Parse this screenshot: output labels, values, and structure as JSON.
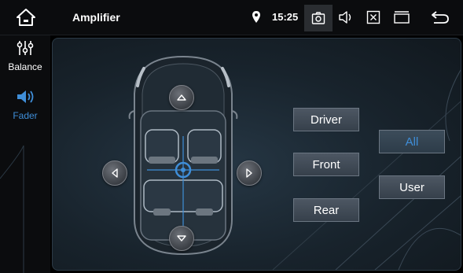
{
  "header": {
    "title": "Amplifier",
    "time": "15:25",
    "icons": [
      "home-icon",
      "location-pin-icon",
      "camera-icon",
      "volume-icon",
      "close-box-icon",
      "window-icon",
      "back-icon"
    ]
  },
  "sidebar": {
    "items": [
      {
        "label": "Balance",
        "icon": "sliders-icon",
        "active": false
      },
      {
        "label": "Fader",
        "icon": "speaker-icon",
        "active": true
      }
    ]
  },
  "main": {
    "modes": {
      "driver": "Driver",
      "front": "Front",
      "rear": "Rear",
      "all": "All",
      "user": "User"
    },
    "selected_mode": "All",
    "arrows": [
      "up-arrow-icon",
      "down-arrow-icon",
      "left-arrow-icon",
      "right-arrow-icon"
    ]
  },
  "colors": {
    "accent": "#3f8ed8",
    "topbar": "#0b0c0e",
    "button": "#4d5763"
  }
}
